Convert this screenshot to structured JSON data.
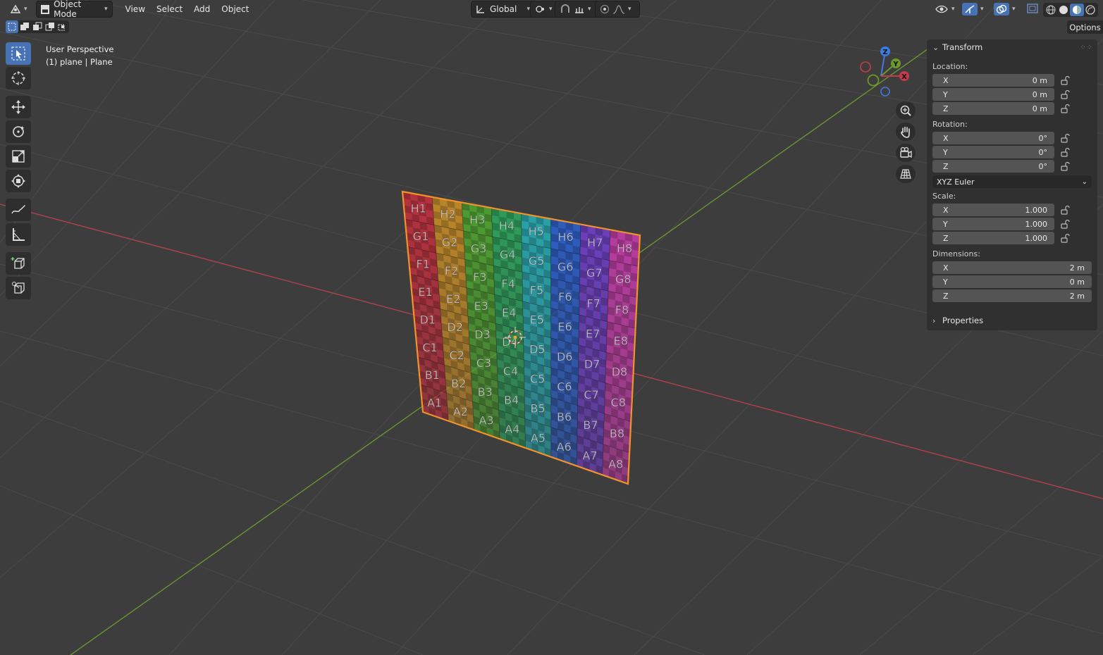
{
  "header": {
    "editor_type_icon": "3d-viewport-icon",
    "mode_label": "Object Mode",
    "menus": [
      "View",
      "Select",
      "Add",
      "Object"
    ],
    "orientation_label": "Global",
    "options_tab": "Options"
  },
  "overlay": {
    "perspective": "User Perspective",
    "object_info": "(1) plane | Plane"
  },
  "toolbar": {
    "tools": [
      "select-box-icon",
      "cursor-icon",
      "move-icon",
      "rotate-icon",
      "scale-icon",
      "transform-icon",
      "annotate-icon",
      "measure-icon",
      "add-cube-icon",
      "knife-cube-icon"
    ]
  },
  "gizmo": {
    "x": "X",
    "y": "Y",
    "z": "Z"
  },
  "colors": {
    "accent": "#4772b3",
    "x_axis": "#c53a4a",
    "y_axis": "#6b9a2a",
    "z_axis": "#3d7be0",
    "selection": "#f1922a"
  },
  "npanel": {
    "transform_title": "Transform",
    "location_label": "Location:",
    "location": [
      {
        "axis": "X",
        "value": "0 m"
      },
      {
        "axis": "Y",
        "value": "0 m"
      },
      {
        "axis": "Z",
        "value": "0 m"
      }
    ],
    "rotation_label": "Rotation:",
    "rotation": [
      {
        "axis": "X",
        "value": "0°"
      },
      {
        "axis": "Y",
        "value": "0°"
      },
      {
        "axis": "Z",
        "value": "0°"
      }
    ],
    "rotation_mode": "XYZ Euler",
    "scale_label": "Scale:",
    "scale": [
      {
        "axis": "X",
        "value": "1.000"
      },
      {
        "axis": "Y",
        "value": "1.000"
      },
      {
        "axis": "Z",
        "value": "1.000"
      }
    ],
    "dimensions_label": "Dimensions:",
    "dimensions": [
      {
        "axis": "X",
        "value": "2 m"
      },
      {
        "axis": "Y",
        "value": "0 m"
      },
      {
        "axis": "Z",
        "value": "2 m"
      }
    ],
    "properties_title": "Properties"
  },
  "plane": {
    "rows": [
      "H",
      "G",
      "F",
      "E",
      "D",
      "C",
      "B",
      "A"
    ],
    "cols": [
      "1",
      "2",
      "3",
      "4",
      "5",
      "6",
      "7",
      "8"
    ],
    "col_colors": [
      "#b4323f",
      "#b8842a",
      "#4e9a32",
      "#2f9a5a",
      "#2a9fa6",
      "#2e5cbc",
      "#6a3fb8",
      "#b43c9c"
    ]
  }
}
